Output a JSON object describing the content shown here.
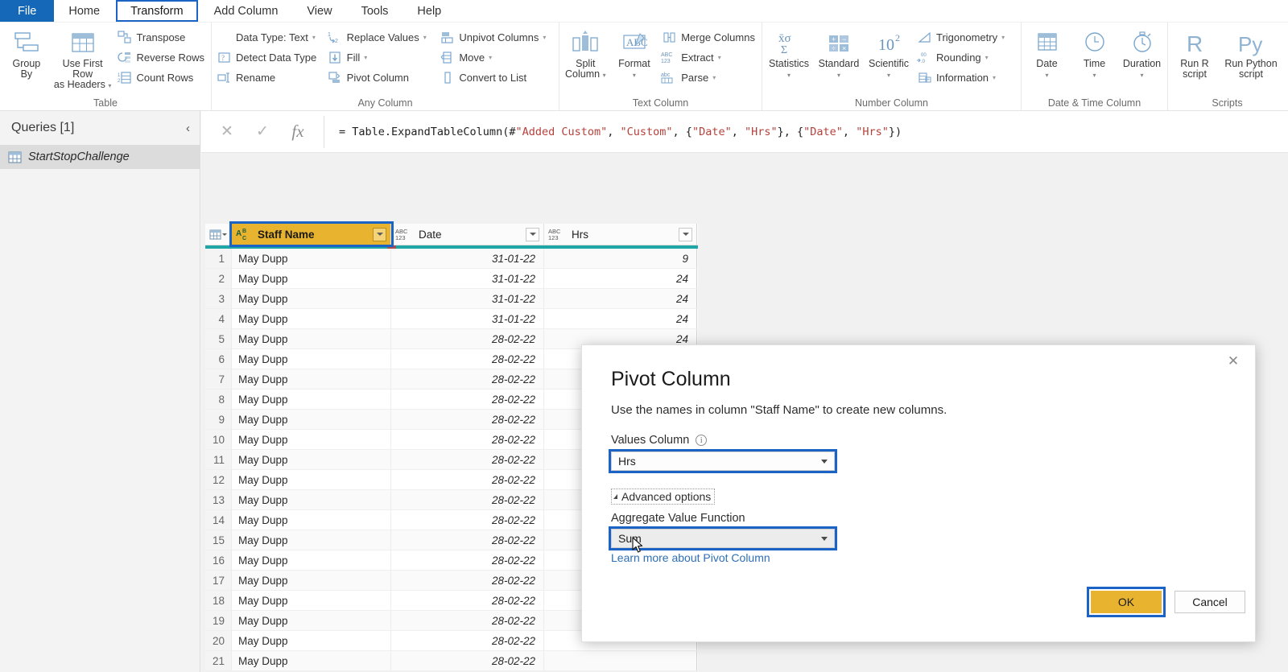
{
  "menu": {
    "items": [
      {
        "label": "File",
        "state": "file"
      },
      {
        "label": "Home",
        "state": "normal"
      },
      {
        "label": "Transform",
        "state": "active"
      },
      {
        "label": "Add Column",
        "state": "normal"
      },
      {
        "label": "View",
        "state": "normal"
      },
      {
        "label": "Tools",
        "state": "normal"
      },
      {
        "label": "Help",
        "state": "normal"
      }
    ]
  },
  "ribbon": {
    "groups": [
      {
        "label": "Table",
        "big": [
          {
            "label": "Group\nBy",
            "icon": "group-by-icon"
          },
          {
            "label": "Use First Row\nas Headers",
            "icon": "use-first-row-icon",
            "caret": true
          }
        ],
        "small": [
          {
            "label": "Transpose",
            "icon": "transpose-icon"
          },
          {
            "label": "Reverse Rows",
            "icon": "reverse-rows-icon"
          },
          {
            "label": "Count Rows",
            "icon": "count-rows-icon"
          }
        ]
      },
      {
        "label": "Any Column",
        "small_a": [
          {
            "label": "Data Type: Text",
            "icon": "data-type-icon",
            "caret": true
          },
          {
            "label": "Detect Data Type",
            "icon": "detect-data-type-icon"
          },
          {
            "label": "Rename",
            "icon": "rename-icon"
          }
        ],
        "small_b": [
          {
            "label": "Replace Values",
            "icon": "replace-values-icon",
            "caret": true
          },
          {
            "label": "Fill",
            "icon": "fill-icon",
            "caret": true
          },
          {
            "label": "Pivot Column",
            "icon": "pivot-column-icon"
          }
        ],
        "small_c": [
          {
            "label": "Unpivot Columns",
            "icon": "unpivot-columns-icon",
            "caret": true
          },
          {
            "label": "Move",
            "icon": "move-icon",
            "caret": true
          },
          {
            "label": "Convert to List",
            "icon": "convert-to-list-icon"
          }
        ]
      },
      {
        "label": "Text Column",
        "big": [
          {
            "label": "Split\nColumn",
            "icon": "split-column-icon",
            "caret": true
          },
          {
            "label": "Format",
            "icon": "format-icon",
            "caret": true
          }
        ],
        "small": [
          {
            "label": "Merge Columns",
            "icon": "merge-columns-icon"
          },
          {
            "label": "Extract",
            "icon": "extract-icon",
            "caret": true
          },
          {
            "label": "Parse",
            "icon": "parse-icon",
            "caret": true
          }
        ]
      },
      {
        "label": "Number Column",
        "big": [
          {
            "label": "Statistics",
            "icon": "statistics-icon",
            "caret": true
          },
          {
            "label": "Standard",
            "icon": "standard-icon",
            "caret": true
          },
          {
            "label": "Scientific",
            "icon": "scientific-icon",
            "caret": true
          }
        ],
        "small": [
          {
            "label": "Trigonometry",
            "icon": "trigonometry-icon",
            "caret": true
          },
          {
            "label": "Rounding",
            "icon": "rounding-icon",
            "caret": true
          },
          {
            "label": "Information",
            "icon": "information-icon",
            "caret": true
          }
        ]
      },
      {
        "label": "Date & Time Column",
        "big": [
          {
            "label": "Date",
            "icon": "date-icon",
            "caret": true
          },
          {
            "label": "Time",
            "icon": "time-icon",
            "caret": true
          },
          {
            "label": "Duration",
            "icon": "duration-icon",
            "caret": true
          }
        ]
      },
      {
        "label": "Scripts",
        "big": [
          {
            "label": "Run R\nscript",
            "icon": "r-script-icon"
          },
          {
            "label": "Run Python\nscript",
            "icon": "python-script-icon"
          }
        ]
      }
    ]
  },
  "formula_bar": {
    "cancel_icon": "✕",
    "confirm_icon": "✓",
    "fx_icon": "fx",
    "prefix": "= Table.ExpandTableColumn(#",
    "s1": "\"Added Custom\"",
    "mid1": ", ",
    "s2": "\"Custom\"",
    "mid2": ", {",
    "s3": "\"Date\"",
    "mid3": ", ",
    "s4": "\"Hrs\"",
    "mid4": "}, {",
    "s5": "\"Date\"",
    "mid5": ", ",
    "s6": "\"Hrs\"",
    "suffix": "})"
  },
  "queries": {
    "title": "Queries [1]",
    "collapse_icon": "‹",
    "items": [
      {
        "label": "StartStopChallenge",
        "icon": "table-icon"
      }
    ]
  },
  "grid": {
    "corner_icon": "select-all-table-icon",
    "columns": [
      {
        "name": "Staff Name",
        "type_icon": "ABC-text-type-icon",
        "type_label_top": "A",
        "type_label_sup": "B",
        "type_label_sub": "C",
        "selected": true
      },
      {
        "name": "Date",
        "type_icon": "ABC123-any-type-icon",
        "type_label_top": "ABC",
        "type_label_bottom": "123",
        "selected": false
      },
      {
        "name": "Hrs",
        "type_icon": "ABC123-any-type-icon",
        "type_label_top": "ABC",
        "type_label_bottom": "123",
        "selected": false
      }
    ],
    "rows": [
      {
        "n": "1",
        "name": "May Dupp",
        "date": "31-01-22",
        "hrs": "9"
      },
      {
        "n": "2",
        "name": "May Dupp",
        "date": "31-01-22",
        "hrs": "24"
      },
      {
        "n": "3",
        "name": "May Dupp",
        "date": "31-01-22",
        "hrs": "24"
      },
      {
        "n": "4",
        "name": "May Dupp",
        "date": "31-01-22",
        "hrs": "24"
      },
      {
        "n": "5",
        "name": "May Dupp",
        "date": "28-02-22",
        "hrs": "24"
      },
      {
        "n": "6",
        "name": "May Dupp",
        "date": "28-02-22",
        "hrs": ""
      },
      {
        "n": "7",
        "name": "May Dupp",
        "date": "28-02-22",
        "hrs": ""
      },
      {
        "n": "8",
        "name": "May Dupp",
        "date": "28-02-22",
        "hrs": ""
      },
      {
        "n": "9",
        "name": "May Dupp",
        "date": "28-02-22",
        "hrs": ""
      },
      {
        "n": "10",
        "name": "May Dupp",
        "date": "28-02-22",
        "hrs": ""
      },
      {
        "n": "11",
        "name": "May Dupp",
        "date": "28-02-22",
        "hrs": ""
      },
      {
        "n": "12",
        "name": "May Dupp",
        "date": "28-02-22",
        "hrs": ""
      },
      {
        "n": "13",
        "name": "May Dupp",
        "date": "28-02-22",
        "hrs": ""
      },
      {
        "n": "14",
        "name": "May Dupp",
        "date": "28-02-22",
        "hrs": ""
      },
      {
        "n": "15",
        "name": "May Dupp",
        "date": "28-02-22",
        "hrs": ""
      },
      {
        "n": "16",
        "name": "May Dupp",
        "date": "28-02-22",
        "hrs": ""
      },
      {
        "n": "17",
        "name": "May Dupp",
        "date": "28-02-22",
        "hrs": ""
      },
      {
        "n": "18",
        "name": "May Dupp",
        "date": "28-02-22",
        "hrs": ""
      },
      {
        "n": "19",
        "name": "May Dupp",
        "date": "28-02-22",
        "hrs": ""
      },
      {
        "n": "20",
        "name": "May Dupp",
        "date": "28-02-22",
        "hrs": ""
      },
      {
        "n": "21",
        "name": "May Dupp",
        "date": "28-02-22",
        "hrs": ""
      }
    ]
  },
  "dialog": {
    "close_icon": "✕",
    "title": "Pivot Column",
    "subtitle": "Use the names in column \"Staff Name\" to create new columns.",
    "values_column_label": "Values Column",
    "info_icon": "i",
    "values_column_value": "Hrs",
    "advanced_options_label": "Advanced options",
    "aggregate_label": "Aggregate Value Function",
    "aggregate_value": "Sum",
    "learn_more": "Learn more about Pivot Column",
    "ok_label": "OK",
    "cancel_label": "Cancel"
  },
  "colors": {
    "accent_blue": "#1567b8",
    "selection_blue": "#1b63c4",
    "highlight_gold": "#e8b430",
    "teal_rule": "#1fa7a7",
    "link_blue": "#2f6fb5"
  }
}
